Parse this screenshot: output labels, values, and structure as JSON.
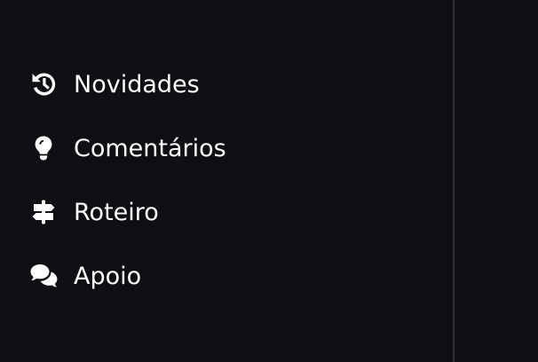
{
  "menu": {
    "items": [
      {
        "label": "Novidades",
        "icon": "history-icon"
      },
      {
        "label": "Comentários",
        "icon": "lightbulb-icon"
      },
      {
        "label": "Roteiro",
        "icon": "signpost-icon"
      },
      {
        "label": "Apoio",
        "icon": "chat-bubbles-icon"
      }
    ]
  },
  "colors": {
    "background": "#0e0f13",
    "divider": "#2e3036",
    "text": "#ffffff"
  }
}
